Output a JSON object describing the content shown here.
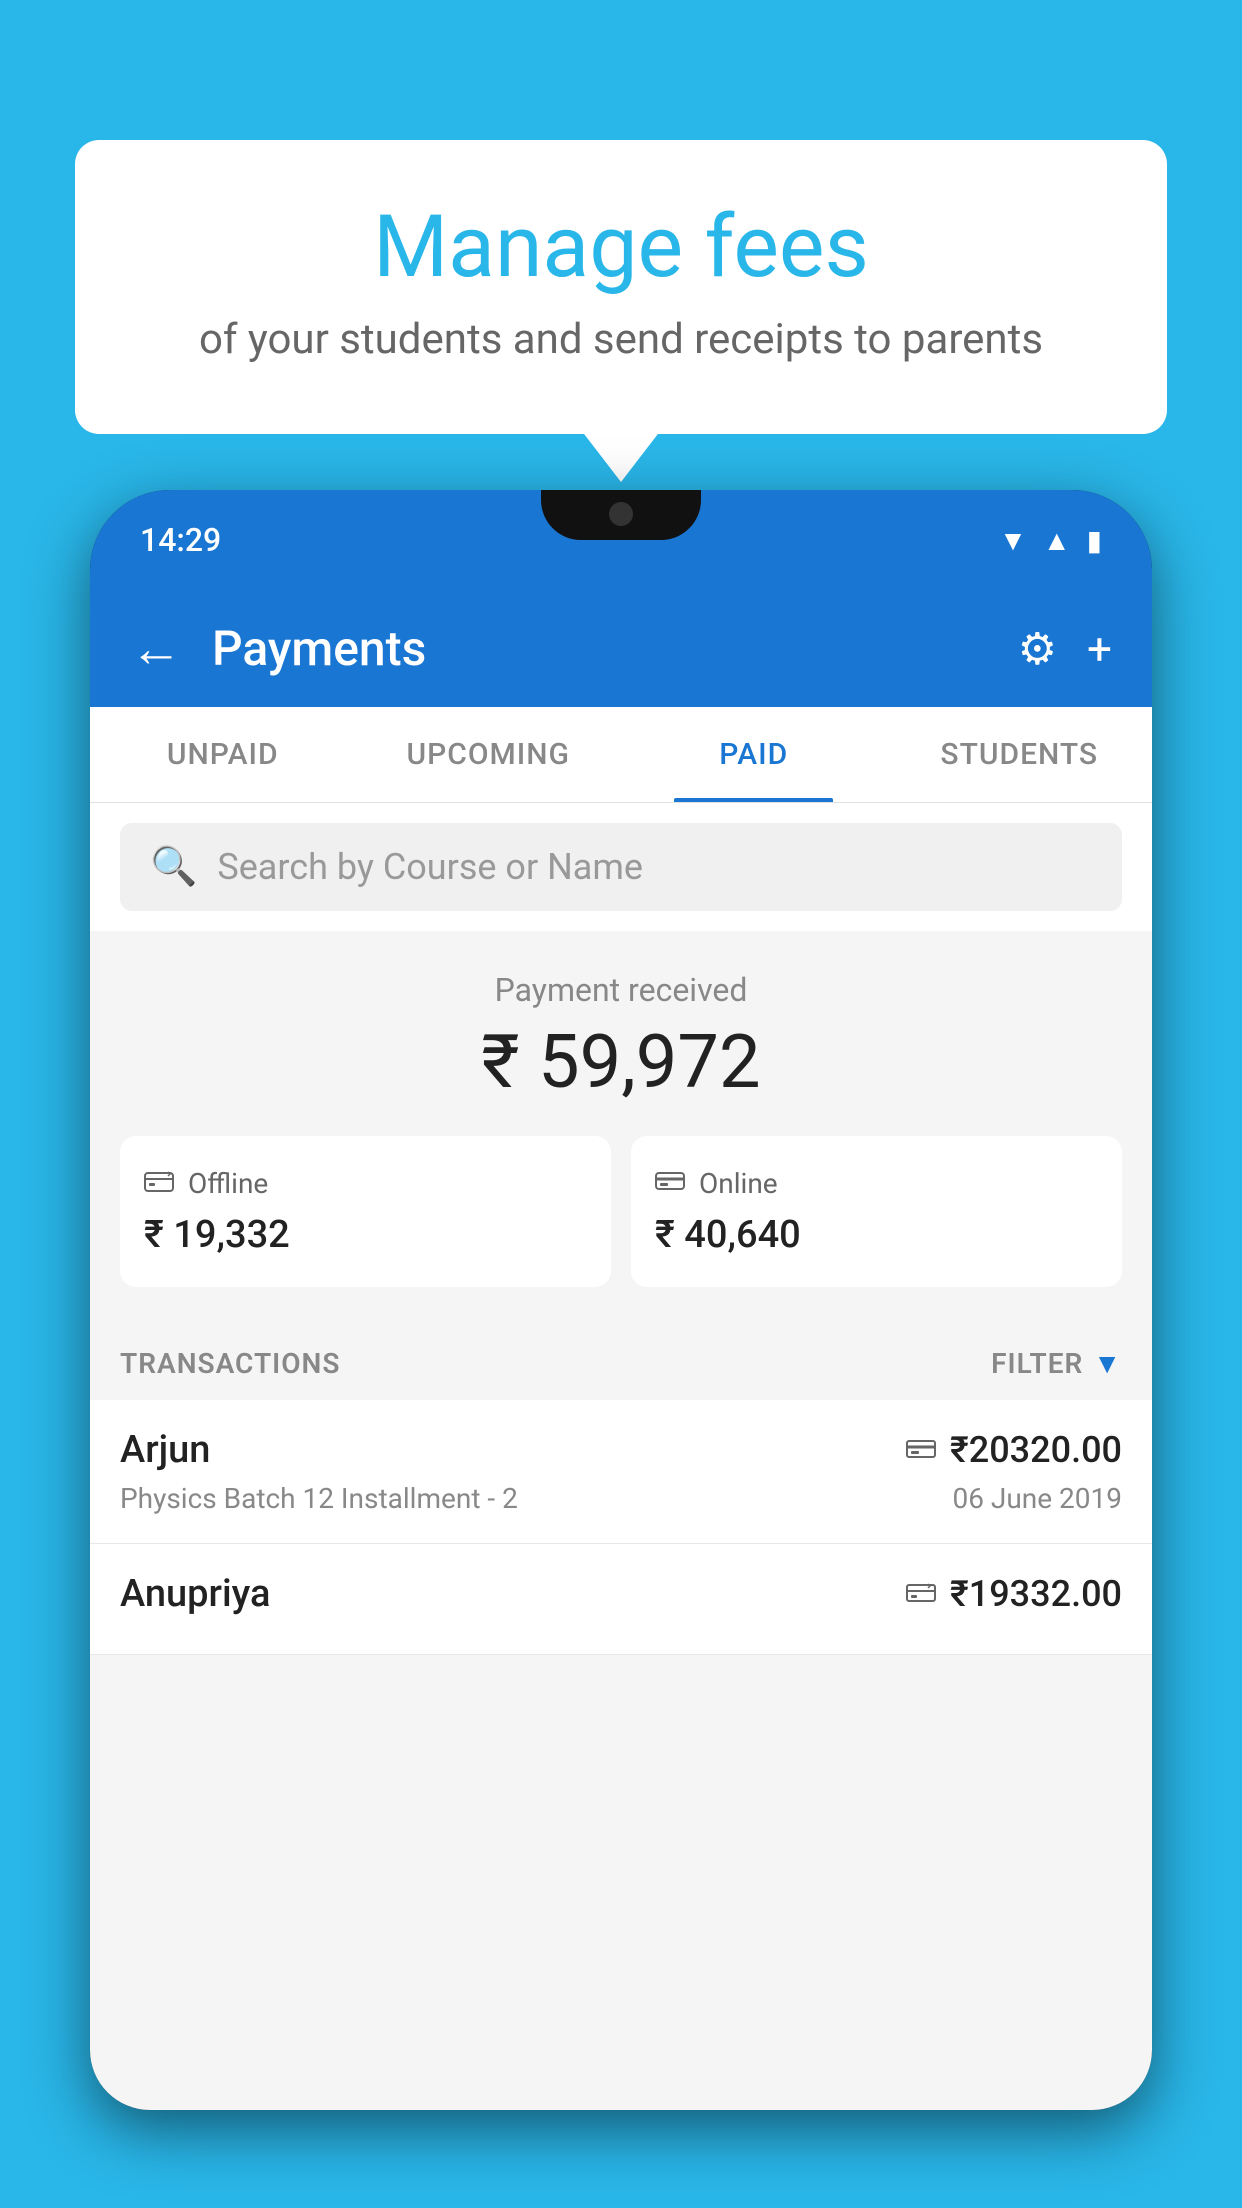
{
  "page": {
    "background_color": "#29B6E8"
  },
  "speech_bubble": {
    "title": "Manage fees",
    "subtitle": "of your students and send receipts to parents"
  },
  "phone": {
    "status_bar": {
      "time": "14:29"
    },
    "header": {
      "title": "Payments",
      "back_label": "←",
      "settings_icon": "⚙",
      "add_icon": "+"
    },
    "tabs": [
      {
        "label": "UNPAID",
        "active": false
      },
      {
        "label": "UPCOMING",
        "active": false
      },
      {
        "label": "PAID",
        "active": true
      },
      {
        "label": "STUDENTS",
        "active": false
      }
    ],
    "search": {
      "placeholder": "Search by Course or Name"
    },
    "payment_summary": {
      "label": "Payment received",
      "total": "₹ 59,972",
      "offline": {
        "icon": "💳",
        "label": "Offline",
        "amount": "₹ 19,332"
      },
      "online": {
        "icon": "💳",
        "label": "Online",
        "amount": "₹ 40,640"
      }
    },
    "transactions": {
      "header_label": "TRANSACTIONS",
      "filter_label": "FILTER",
      "items": [
        {
          "name": "Arjun",
          "course": "Physics Batch 12 Installment - 2",
          "amount": "₹20320.00",
          "date": "06 June 2019",
          "type": "online"
        },
        {
          "name": "Anupriya",
          "course": "",
          "amount": "₹19332.00",
          "date": "",
          "type": "offline"
        }
      ]
    }
  }
}
